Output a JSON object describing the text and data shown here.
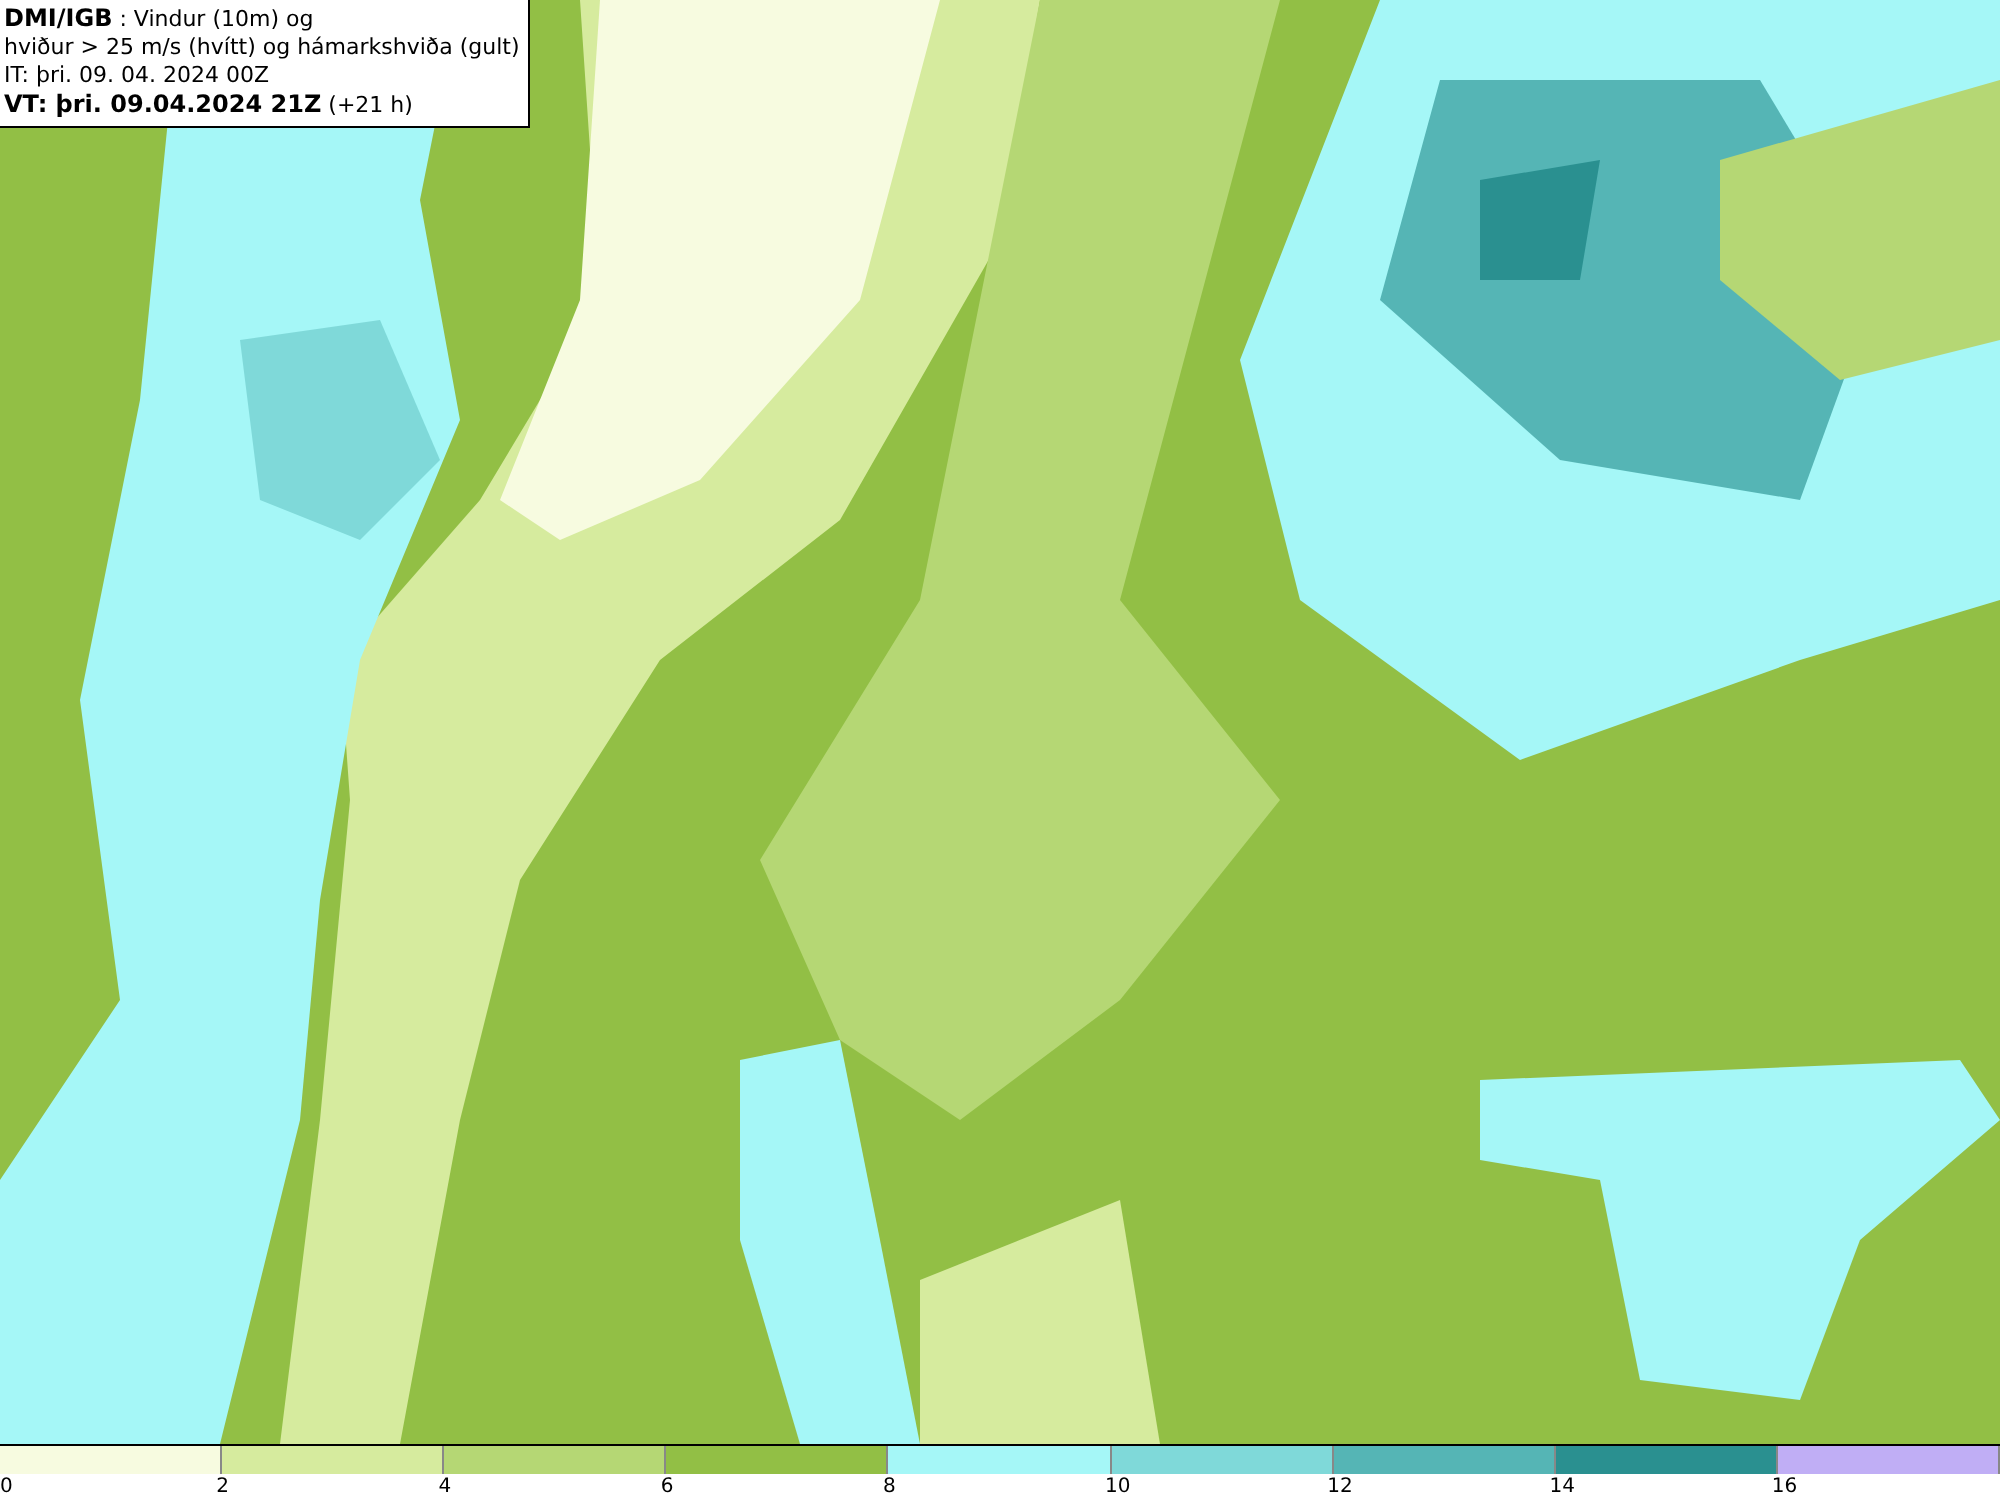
{
  "title_box": {
    "lines": [
      "**DMI/IGB** : Vindur (10m) og",
      "hviður > 25 m/s (hvítt) og hámarkshviða (gult)",
      "IT: þri. 09. 04. 2024 00Z",
      "**VT: þri. 09.04.2024 21Z** (+21 h)"
    ]
  },
  "legend": {
    "segments": [
      {
        "color": "#f7fbe0",
        "label": "0"
      },
      {
        "color": "#d6eb9e",
        "label": "2"
      },
      {
        "color": "#b5d774",
        "label": "4"
      },
      {
        "color": "#92bf45",
        "label": "6"
      },
      {
        "color": "#a5f7f7",
        "label": "8"
      },
      {
        "color": "#7fd9d9",
        "label": "10"
      },
      {
        "color": "#55b5b5",
        "label": "12"
      },
      {
        "color": "#2a9090",
        "label": "14"
      },
      {
        "color": "#c0aef5",
        "label": "16"
      }
    ]
  }
}
